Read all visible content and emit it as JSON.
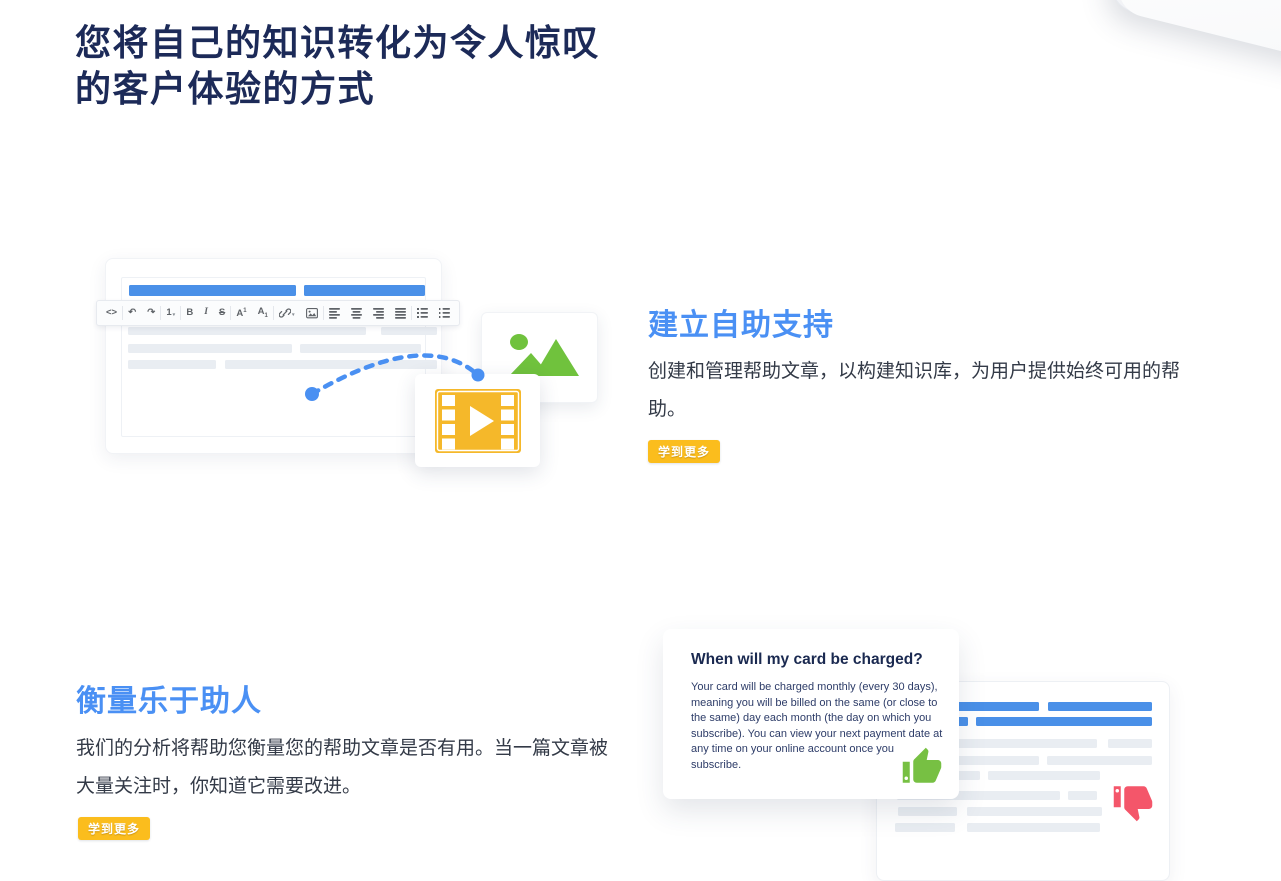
{
  "hero": {
    "title_line1": "您将自己的知识转化为令人惊叹",
    "title_line2": "的客户体验的方式"
  },
  "sections": {
    "self_service": {
      "title": "建立自助支持",
      "body": "创建和管理帮助文章，以构建知识库，为用户提供始终可用的帮助。",
      "cta": "学到更多"
    },
    "helpfulness": {
      "title": "衡量乐于助人",
      "body": "我们的分析将帮助您衡量您的帮助文章是否有用。当一篇文章被大量关注时，你知道它需要改进。",
      "cta": "学到更多"
    }
  },
  "faq_card": {
    "title": "When will my card be charged?",
    "body": "Your card will be charged monthly (every 30 days), meaning you will be billed on the same (or close to the same) day each month (the day on which you subscribe). You can view your next payment date at any time on your online account once you subscribe."
  },
  "editor": {
    "toolbar_groups": [
      [
        "code"
      ],
      [
        "undo",
        "redo"
      ],
      [
        "paragraph-format"
      ],
      [
        "bold",
        "italic",
        "strikethrough"
      ],
      [
        "superscript",
        "subscript"
      ],
      [
        "insert-link",
        "insert-image"
      ],
      [
        "align-left",
        "align-center",
        "align-right",
        "align-justify"
      ],
      [
        "list-unordered",
        "list-ordered"
      ]
    ]
  },
  "colors": {
    "navy_heading": "#1c2a58",
    "accent_blue": "#4a90f4",
    "bar_blue": "#4a90e8",
    "bar_gray": "#e9edf2",
    "button_yellow": "#fbbd1d",
    "thumb_green": "#77c043",
    "thumb_red": "#f4566a",
    "video_yellow": "#f5b82a",
    "image_green": "#70c23d"
  }
}
